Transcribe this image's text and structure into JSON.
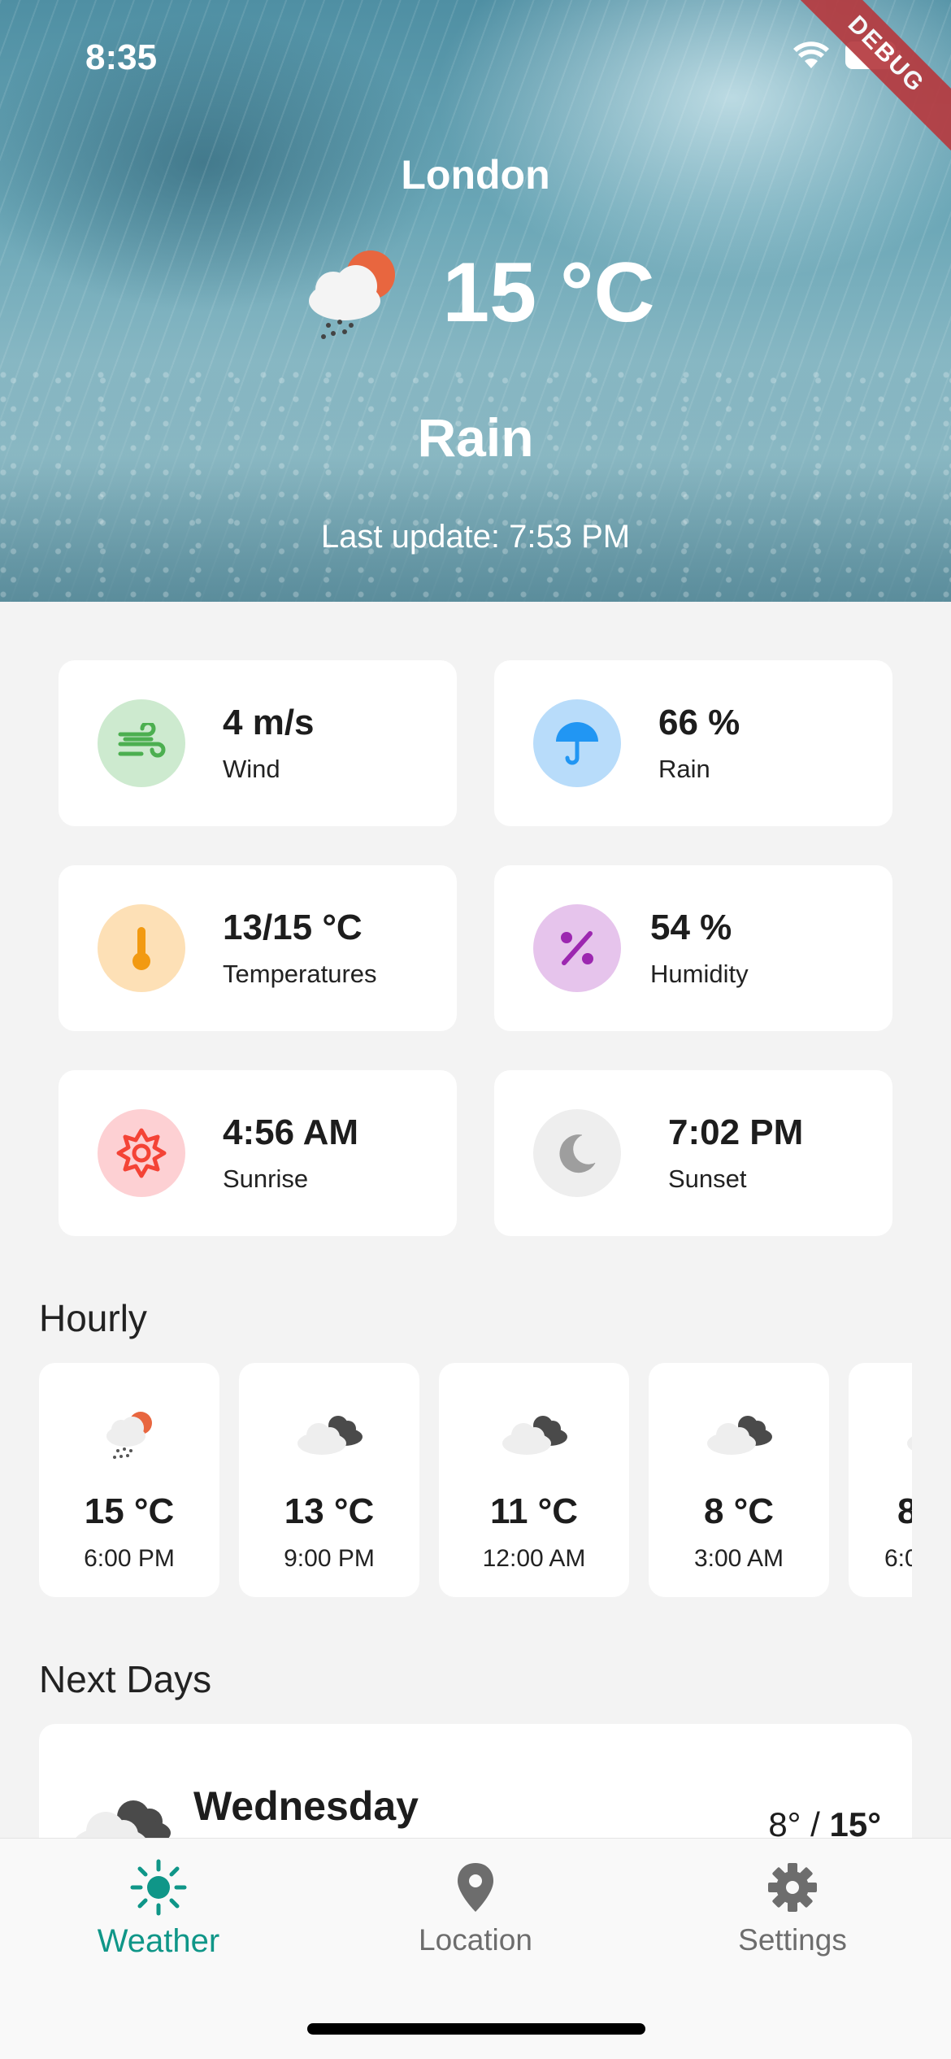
{
  "status_bar": {
    "time": "8:35",
    "debug_label": "DEBUG"
  },
  "hero": {
    "city": "London",
    "temperature": "15 °C",
    "condition": "Rain",
    "last_update": "Last update: 7:53 PM"
  },
  "details": [
    {
      "value": "4 m/s",
      "label": "Wind",
      "icon": "wind-icon",
      "bg": "#cdeacf",
      "color": "#4caf50"
    },
    {
      "value": "66 %",
      "label": "Rain",
      "icon": "umbrella-icon",
      "bg": "#b8dcfa",
      "color": "#2196f3"
    },
    {
      "value": "13/15 °C",
      "label": "Temperatures",
      "icon": "thermometer-icon",
      "bg": "#fde0b6",
      "color": "#f29a12"
    },
    {
      "value": "54 %",
      "label": "Humidity",
      "icon": "percent-icon",
      "bg": "#e6c4ec",
      "color": "#9c27b0"
    },
    {
      "value": "4:56 AM",
      "label": "Sunrise",
      "icon": "sunrise-icon",
      "bg": "#fdd0d3",
      "color": "#f44336"
    },
    {
      "value": "7:02 PM",
      "label": "Sunset",
      "icon": "moon-icon",
      "bg": "#eeeeee",
      "color": "#9e9e9e"
    }
  ],
  "hourly": {
    "title": "Hourly",
    "items": [
      {
        "temp": "15 °C",
        "time": "6:00 PM",
        "icon": "rain-sun-icon"
      },
      {
        "temp": "13 °C",
        "time": "9:00 PM",
        "icon": "cloudy-icon"
      },
      {
        "temp": "11 °C",
        "time": "12:00 AM",
        "icon": "cloudy-icon"
      },
      {
        "temp": "8 °C",
        "time": "3:00 AM",
        "icon": "cloudy-icon"
      },
      {
        "temp": "8",
        "time": "6:0",
        "icon": "cloudy-icon"
      }
    ]
  },
  "next_days": {
    "title": "Next Days",
    "items": [
      {
        "day": "Wednesday",
        "min": "8°",
        "sep": " / ",
        "max": "15°",
        "icon": "cloudy-icon"
      }
    ]
  },
  "nav": {
    "items": [
      {
        "label": "Weather",
        "icon": "sun-icon",
        "active": true
      },
      {
        "label": "Location",
        "icon": "location-pin-icon",
        "active": false
      },
      {
        "label": "Settings",
        "icon": "gear-icon",
        "active": false
      }
    ],
    "active_color": "#0f9688",
    "inactive_color": "#6d6d6d"
  }
}
